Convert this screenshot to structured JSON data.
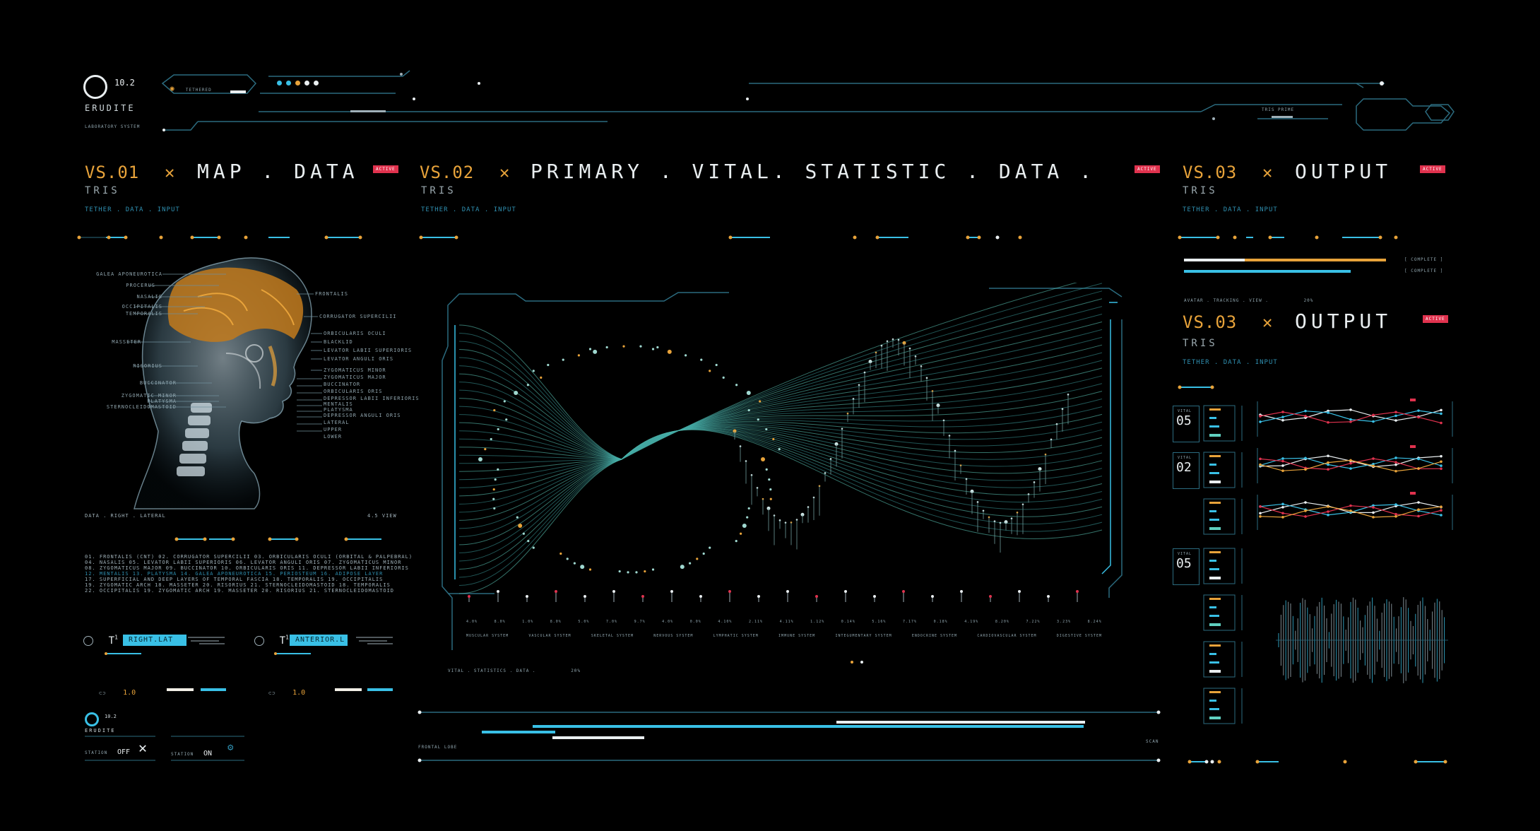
{
  "logo": {
    "number": "10.2",
    "name": "ERUDITE",
    "tagline": "LABORATORY SYSTEM"
  },
  "topbar": {
    "tether_label": "TETHERED",
    "tris_label": "TRIS PRIME"
  },
  "panel1": {
    "code": "VS.01",
    "title": "MAP . DATA",
    "sub": "TRIS",
    "tether": "TETHER . DATA . INPUT",
    "badge": "ACTIVE"
  },
  "panel2": {
    "code": "VS.02",
    "title": "PRIMARY . VITAL. STATISTIC . DATA .",
    "sub": "TRIS",
    "tether": "TETHER . DATA . INPUT",
    "badge": "ACTIVE"
  },
  "panel3": {
    "code": "VS.03",
    "title": "OUTPUT",
    "sub": "TRIS",
    "tether": "TETHER . DATA . INPUT",
    "badge": "ACTIVE",
    "complete1": "[ COMPLETE ]",
    "complete2": "[ COMPLETE ]",
    "tracking": "AVATAR . TRACKING . VIEW .",
    "tracking_val": "20%"
  },
  "panel4": {
    "code": "VS.03",
    "title": "OUTPUT",
    "sub": "TRIS",
    "tether": "TETHER . DATA . INPUT",
    "badge": "ACTIVE"
  },
  "head_labels_left": [
    "GALEA APONEUROTICA",
    "PROCERUS",
    "NASALIS",
    "OCCIPITALIS",
    "TEMPORALIS",
    "MASSETER",
    "RISORIUS",
    "BUCCINATOR",
    "ZYGOMATIC MINOR",
    "PLATYSMA",
    "STERNOCLEIDOMASTOID"
  ],
  "head_labels_right": [
    "FRONTALIS",
    "CORRUGATOR SUPERCILII",
    "ORBICULARIS OCULI",
    "BLACKLID",
    "LEVATOR LABII SUPERIORIS",
    "LEVATOR ANGULI ORIS",
    "ZYGOMATICUS MINOR",
    "ZYGOMATICUS MAJOR",
    "BUCCINATOR",
    "ORBICULARIS ORIS",
    "DEPRESSOR LABII INFERIORIS",
    "MENTALIS",
    "PLATYSMA",
    "DEPRESSOR ANGULI ORIS",
    "LATERAL",
    "UPPER",
    "LOWER"
  ],
  "view": {
    "left": "DATA . RIGHT . LATERAL",
    "right": "4.5 VIEW"
  },
  "muscle_list": [
    "01. FRONTALIS (CNT) 02. CORRUGATOR SUPERCILII 03. ORBICULARIS OCULI (ORBITAL & PALPEBRAL)",
    "04. NASALIS 05. LEVATOR LABII SUPERIORIS 06. LEVATOR ANGULI ORIS 07. ZYGOMATICUS MINOR",
    "08. ZYGOMATICUS MAJOR 09. BUCCINATOR 10. ORBICULARIS ORIS 11. DEPRESSOR LABII INFERIORIS",
    "12. MENTALIS 13. PLATYSMA 14. GALEA APONEUROTICA 15. PERIOSTEUM 16. ADIPOSE LAYER",
    "17. SUPERFICIAL AND DEEP LAYERS OF TEMPORAL FASCIA 18. TEMPORALIS 19. OCCIPITALIS",
    "19. ZYGOMATIC ARCH 18. MASSETER 20. RISORIUS 21. STERNOCLEIDOMASTOID 18. TEMPORALIS",
    "22. OCCIPITALIS 19. ZYGOMATIC ARCH 19. MASSETER 20. RISORIUS 21. STERNOCLEIDOMASTOID"
  ],
  "controls": [
    {
      "tag": "T",
      "sup": "1",
      "chip": "RIGHT.LAT",
      "value": "1.0"
    },
    {
      "tag": "T",
      "sup": "1",
      "chip": "ANTERIOR.L",
      "value": "1.0"
    }
  ],
  "bottom_logo": {
    "number": "10.2",
    "name": "ERUDITE"
  },
  "stations": [
    {
      "label": "STATION",
      "state": "OFF"
    },
    {
      "label": "STATION",
      "state": "ON"
    }
  ],
  "systems": [
    "MUSCULAR SYSTEM",
    "VASCULAR SYSTEM",
    "SKELETAL SYSTEM",
    "NERVOUS SYSTEM",
    "LYMPHATIC SYSTEM",
    "IMMUNE SYSTEM",
    "INTEGUMENTARY SYSTEM",
    "ENDOCRINE SYSTEM",
    "CARDIOVASCULAR SYSTEM",
    "DIGESTIVE SYSTEM"
  ],
  "tick_values": [
    "4.0%",
    "8.0%",
    "1.0%",
    "8.0%",
    "5.0%",
    "7.0%",
    "9.7%",
    "4.0%",
    "0.0%",
    "4.10%",
    "2.11%",
    "4.11%",
    "1.12%",
    "0.14%",
    "5.16%",
    "7.17%",
    "0.18%",
    "4.19%",
    "8.20%",
    "7.22%",
    "3.23%",
    "8.24%"
  ],
  "stats_caption": {
    "label": "VITAL . STATISTICS . DATA .",
    "value": "20%"
  },
  "bottom_left": "FRONTAL LOBE",
  "bottom_right": "SCAN",
  "vitals": [
    {
      "label": "VITAL",
      "value": "05"
    },
    {
      "label": "VITAL",
      "value": "02"
    },
    {
      "label": "VITAL",
      "value": "05"
    }
  ],
  "colors": {
    "accent": "#e8a33a",
    "cyan": "#39c0e6",
    "teal": "#5fd0c0",
    "alert": "#e0324e",
    "line": "#2b6b7f"
  }
}
